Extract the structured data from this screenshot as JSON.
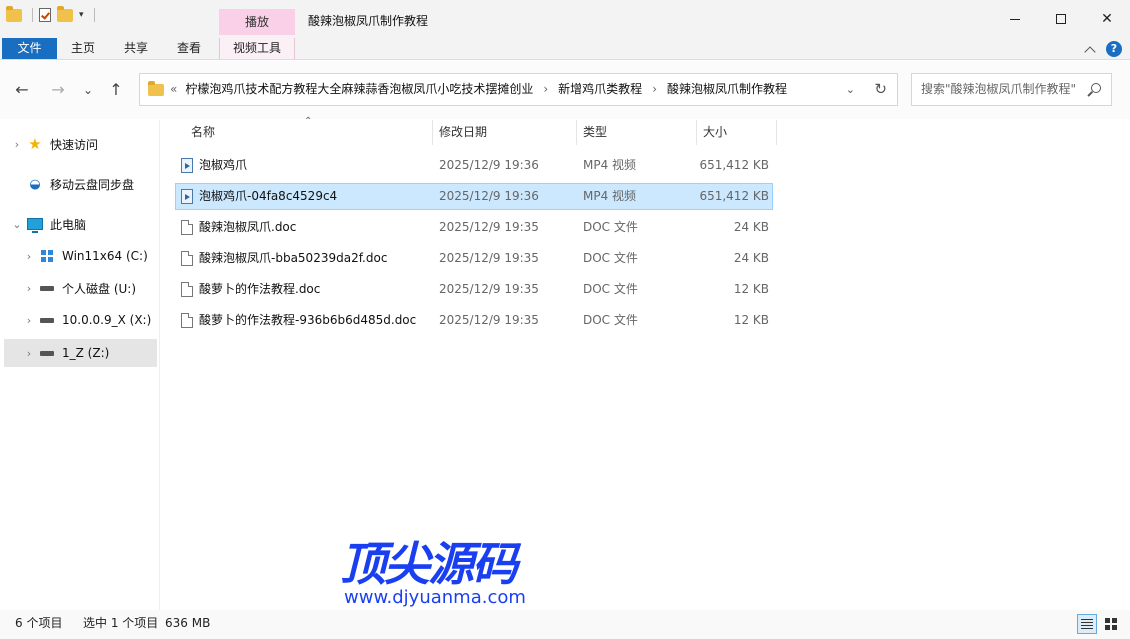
{
  "window": {
    "title": "酸辣泡椒凤爪制作教程",
    "context_tab_group": "播放",
    "controls": {
      "minimize": "",
      "maximize": "",
      "close": "✕"
    }
  },
  "ribbon": {
    "tabs": [
      "文件",
      "主页",
      "共享",
      "查看",
      "视频工具"
    ],
    "help": "?"
  },
  "navigation": {
    "back": "←",
    "forward": "→",
    "recent": "⌄",
    "up": "↑"
  },
  "address": {
    "overflow": "«",
    "crumbs": [
      "柠檬泡鸡爪技术配方教程大全麻辣蒜香泡椒凤爪小吃技术摆摊创业",
      "新增鸡爪类教程",
      "酸辣泡椒凤爪制作教程"
    ],
    "separator": "›",
    "dropdown": "⌄",
    "refresh": "↻"
  },
  "search": {
    "placeholder": "搜索\"酸辣泡椒凤爪制作教程\""
  },
  "nav_pane": {
    "items": [
      {
        "label": "快速访问",
        "expander": "›"
      },
      {
        "label": "移动云盘同步盘",
        "expander": ""
      },
      {
        "label": "此电脑",
        "expander": "⌄"
      },
      {
        "label": "Win11x64 (C:)",
        "expander": "›"
      },
      {
        "label": "个人磁盘 (U:)",
        "expander": "›"
      },
      {
        "label": "10.0.0.9_X (X:)",
        "expander": "›"
      },
      {
        "label": "1_Z (Z:)",
        "expander": "›"
      }
    ]
  },
  "columns": {
    "name": "名称",
    "date": "修改日期",
    "type": "类型",
    "size": "大小",
    "sort_indicator": "⌃"
  },
  "files": [
    {
      "name": "泡椒鸡爪",
      "date": "2025/12/9 19:36",
      "type": "MP4 视频",
      "size": "651,412 KB",
      "icon": "video-file-icon"
    },
    {
      "name": "泡椒鸡爪-04fa8c4529c4",
      "date": "2025/12/9 19:36",
      "type": "MP4 视频",
      "size": "651,412 KB",
      "icon": "video-file-icon"
    },
    {
      "name": "酸辣泡椒凤爪.doc",
      "date": "2025/12/9 19:35",
      "type": "DOC 文件",
      "size": "24 KB",
      "icon": "doc-file-icon"
    },
    {
      "name": "酸辣泡椒凤爪-bba50239da2f.doc",
      "date": "2025/12/9 19:35",
      "type": "DOC 文件",
      "size": "24 KB",
      "icon": "doc-file-icon"
    },
    {
      "name": "酸萝卜的作法教程.doc",
      "date": "2025/12/9 19:35",
      "type": "DOC 文件",
      "size": "12 KB",
      "icon": "doc-file-icon"
    },
    {
      "name": "酸萝卜的作法教程-936b6b6d485d.doc",
      "date": "2025/12/9 19:35",
      "type": "DOC 文件",
      "size": "12 KB",
      "icon": "doc-file-icon"
    }
  ],
  "watermark": {
    "title": "顶尖源码",
    "url": "www.djyuanma.com"
  },
  "status": {
    "count": "6 个项目",
    "selection": "选中 1 个项目",
    "size": "636 MB"
  },
  "colors": {
    "accent": "#1a6ec2",
    "context_tab": "#f9d0e8",
    "selection": "#cce8ff",
    "watermark": "#1a3ff0"
  }
}
